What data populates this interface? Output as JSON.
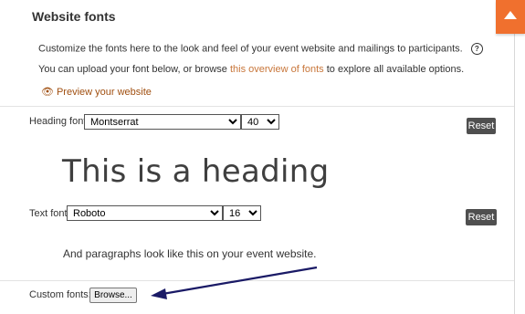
{
  "section": {
    "title": "Website fonts",
    "description_1": "Customize the fonts here to the look and feel of your event website and mailings to participants.",
    "description_2_prefix": "You can upload your font below, or browse ",
    "description_2_link": "this overview of fonts",
    "description_2_suffix": " to explore all available options.",
    "preview_link": "Preview your website"
  },
  "heading_font": {
    "label": "Heading font:",
    "family": "Montserrat",
    "size": "40",
    "reset_label": "Reset",
    "sample_text": "This is a heading"
  },
  "text_font": {
    "label": "Text font:",
    "family": "Roboto",
    "size": "16",
    "reset_label": "Reset",
    "sample_text": "And paragraphs look like this on your event website."
  },
  "custom_fonts": {
    "label": "Custom fonts:",
    "browse_label": "Browse..."
  },
  "colors": {
    "accent": "#f0702e",
    "link": "#c8763a",
    "reset_button": "#4f4f4f",
    "annotation_arrow": "#1a1a66"
  },
  "icons": [
    "help-icon",
    "eye-icon",
    "caret-up-icon",
    "annotation-arrow"
  ]
}
